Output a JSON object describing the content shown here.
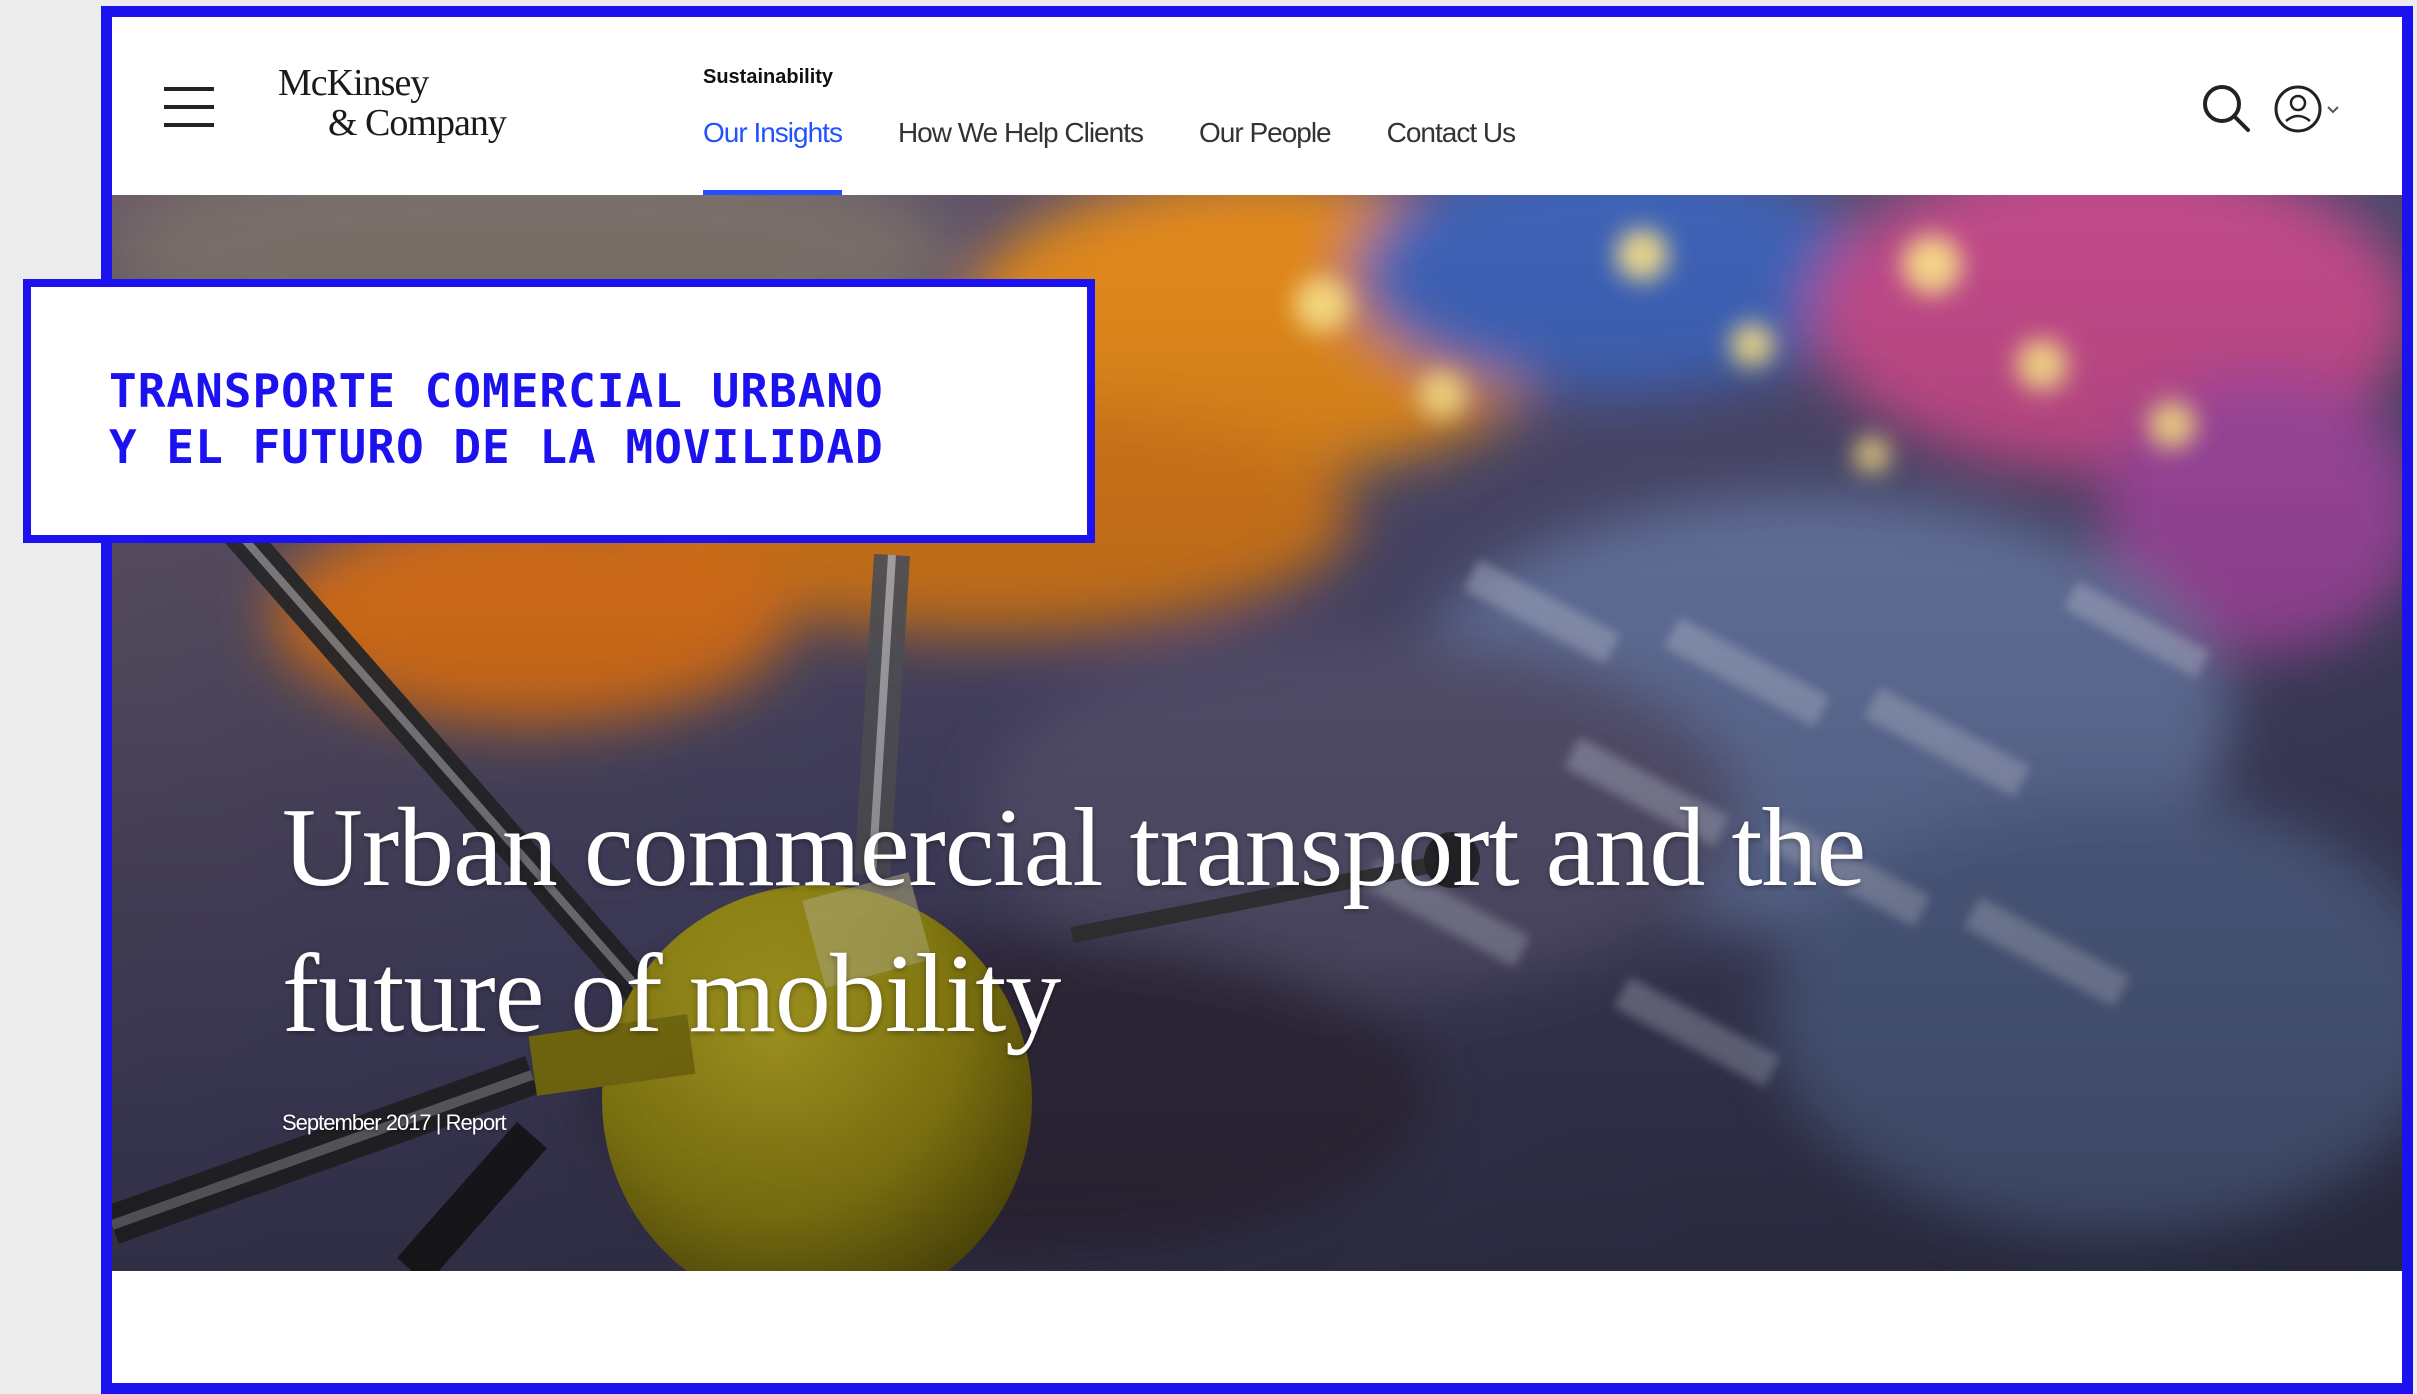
{
  "header": {
    "logo_line1": "McKinsey",
    "logo_line2": "& Company",
    "section_label": "Sustainability",
    "nav": [
      {
        "label": "Our Insights",
        "active": true
      },
      {
        "label": "How We Help Clients",
        "active": false
      },
      {
        "label": "Our People",
        "active": false
      },
      {
        "label": "Contact Us",
        "active": false
      }
    ],
    "icons": [
      "menu-icon",
      "search-icon",
      "account-icon",
      "chevron-down-icon"
    ]
  },
  "hero": {
    "title": "Urban commercial transport and the future of mobility",
    "meta": "September 2017 | Report"
  },
  "overlay": {
    "text": "TRANSPORTE COMERCIAL URBANO\nY EL FUTURO DE LA MOVILIDAD"
  },
  "colors": {
    "frame": "#1c12ef",
    "accent": "#2251ff",
    "drone_yellow": "#c9b81a"
  }
}
